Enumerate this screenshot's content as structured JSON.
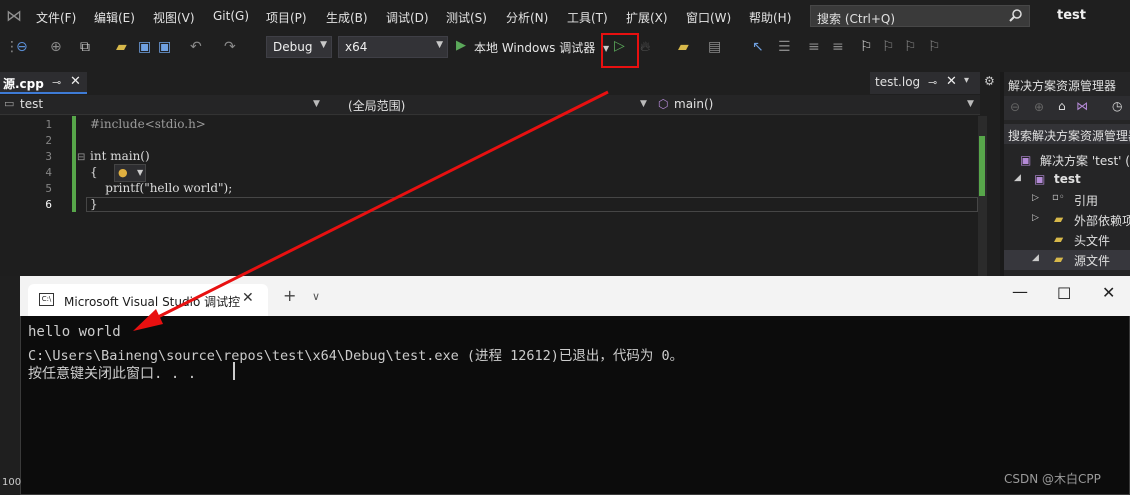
{
  "menubar": {
    "items": [
      "文件(F)",
      "编辑(E)",
      "视图(V)",
      "Git(G)",
      "项目(P)",
      "生成(B)",
      "调试(D)",
      "测试(S)",
      "分析(N)",
      "工具(T)",
      "扩展(X)",
      "窗口(W)",
      "帮助(H)"
    ],
    "search_placeholder": "搜索 (Ctrl+Q)",
    "app_title": "test"
  },
  "toolbar": {
    "config": "Debug",
    "platform": "x64",
    "run_label": "本地 Windows 调试器"
  },
  "editor": {
    "tabs": [
      {
        "label": "源.cpp"
      },
      {
        "label": "test.log"
      }
    ],
    "nav": {
      "project": "test",
      "scope": "(全局范围)",
      "member": "main()"
    },
    "line_numbers": [
      "1",
      "2",
      "3",
      "4",
      "5",
      "6"
    ],
    "lines": [
      "#include<stdio.h>",
      "",
      "int main()",
      "{",
      "    printf(\"hello world\");",
      "}"
    ]
  },
  "solution_explorer": {
    "title": "解决方案资源管理器",
    "search": "搜索解决方案资源管理器",
    "tree": [
      "解决方案 'test' (1",
      "test",
      "引用",
      "外部依赖项",
      "头文件",
      "源文件"
    ]
  },
  "console": {
    "tab_title": "Microsoft Visual Studio 调试控",
    "lines": [
      "hello world",
      "C:\\Users\\Baineng\\source\\repos\\test\\x64\\Debug\\test.exe (进程 12612)已退出，代码为 0。",
      "按任意键关闭此窗口. . ."
    ]
  },
  "status": {
    "zoom": "100"
  },
  "watermark": "CSDN @木白CPP",
  "colors": {
    "annotation_red": "#e81010",
    "run_green": "#5ba85a",
    "console_bg": "#0c0c0c"
  }
}
